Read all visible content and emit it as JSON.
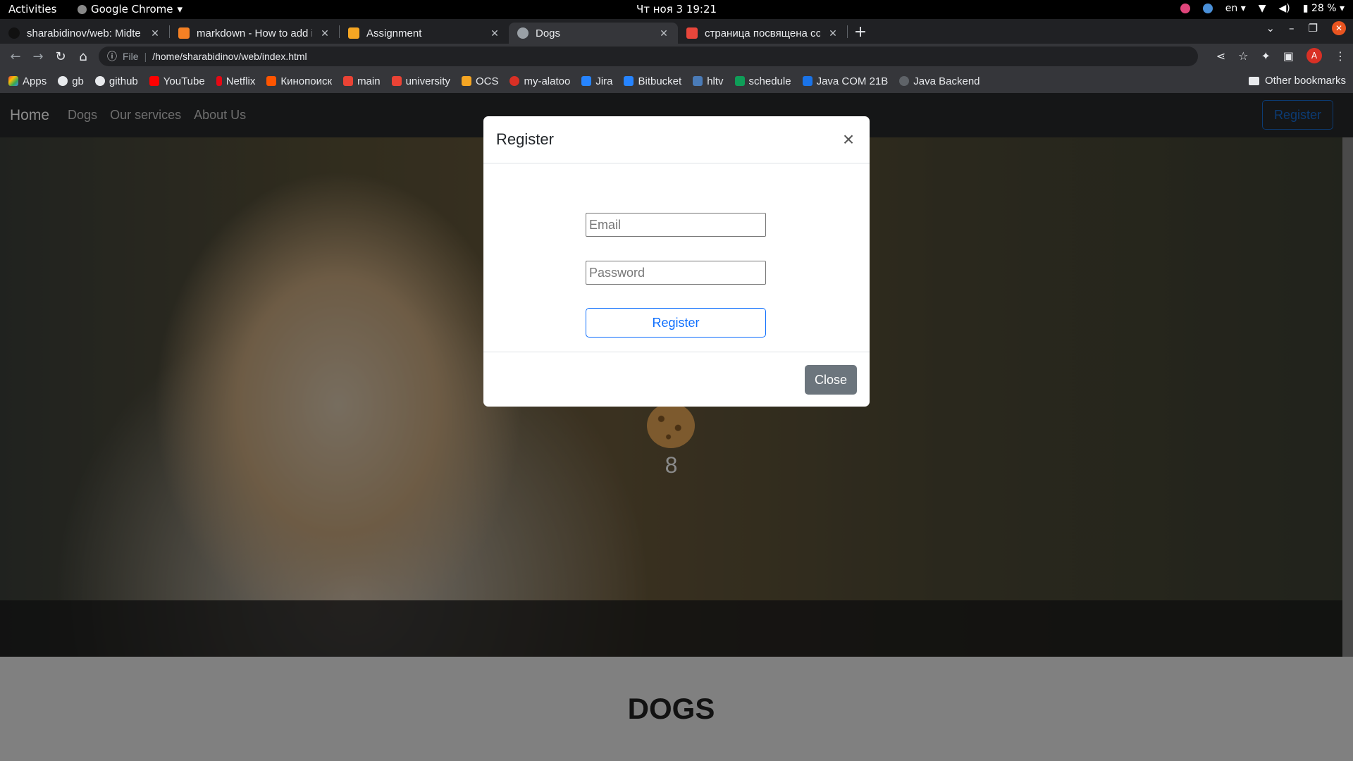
{
  "system_bar": {
    "activities": "Activities",
    "app_name": "Google Chrome",
    "clock": "Чт ноя 3  19:21",
    "language": "en",
    "battery": "28 %"
  },
  "browser": {
    "tabs": [
      {
        "title": "sharabidinov/web: Midte",
        "favicon_color": "#111111",
        "active": false
      },
      {
        "title": "markdown - How to add i",
        "favicon_color": "#f48024",
        "active": false
      },
      {
        "title": "Assignment",
        "favicon_color": "#f5a623",
        "active": false
      },
      {
        "title": "Dogs",
        "favicon_color": "#9aa0a6",
        "active": true
      },
      {
        "title": "страница посвящена соб",
        "favicon_color": "#e8463b",
        "active": false
      }
    ],
    "url_scheme": "File",
    "url": "/home/sharabidinov/web/index.html",
    "profile_initial": "A",
    "bookmarks": [
      {
        "label": "Apps",
        "color": "#4285f4"
      },
      {
        "label": "gb",
        "color": "#e8eaed"
      },
      {
        "label": "github",
        "color": "#e8eaed"
      },
      {
        "label": "YouTube",
        "color": "#ff0000"
      },
      {
        "label": "Netflix",
        "color": "#e50914"
      },
      {
        "label": "Кинопоиск",
        "color": "#ff5500"
      },
      {
        "label": "main",
        "color": "#ea4335"
      },
      {
        "label": "university",
        "color": "#ea4335"
      },
      {
        "label": "OCS",
        "color": "#f5a623"
      },
      {
        "label": "my-alatoo",
        "color": "#d93025"
      },
      {
        "label": "Jira",
        "color": "#2684ff"
      },
      {
        "label": "Bitbucket",
        "color": "#2684ff"
      },
      {
        "label": "hltv",
        "color": "#4a7bb7"
      },
      {
        "label": "schedule",
        "color": "#0f9d58"
      },
      {
        "label": "Java COM 21B",
        "color": "#1a73e8"
      },
      {
        "label": "Java Backend",
        "color": "#5f6368"
      }
    ],
    "other_bookmarks": "Other bookmarks"
  },
  "page": {
    "nav": {
      "brand": "Home",
      "links": [
        "Dogs",
        "Our services",
        "About Us"
      ],
      "register": "Register"
    },
    "counter": "8",
    "section_heading": "DOGS"
  },
  "modal": {
    "title": "Register",
    "close_icon": "×",
    "email_placeholder": "Email",
    "password_placeholder": "Password",
    "submit_label": "Register",
    "close_label": "Close"
  }
}
